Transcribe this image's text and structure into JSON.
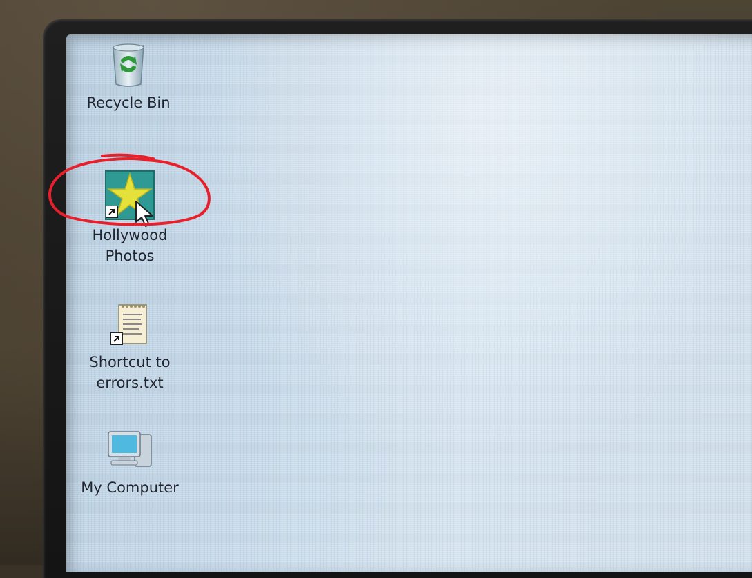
{
  "desktop": {
    "icons": [
      {
        "label": "Recycle Bin",
        "icon": "recycle-bin-icon"
      },
      {
        "label": "Hollywood\nPhotos",
        "icon": "star-icon",
        "shortcut": true,
        "highlighted": true
      },
      {
        "label": "Shortcut to\nerrors.txt",
        "icon": "text-file-icon",
        "shortcut": true
      },
      {
        "label": "My Computer",
        "icon": "computer-icon"
      }
    ]
  },
  "colors": {
    "annotation": "#e8202c",
    "wallpaper": "#c7d9e8",
    "bezel": "#1a1a1a"
  }
}
